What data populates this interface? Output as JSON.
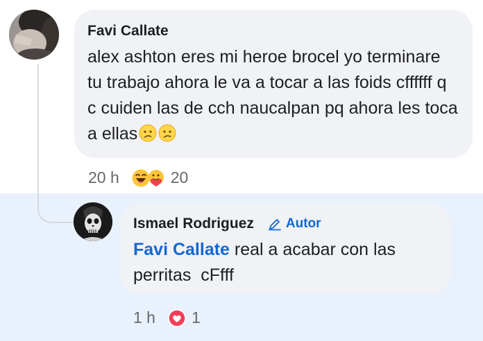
{
  "colors": {
    "mention": "#1467d6",
    "reply_background": "#e9f1fc",
    "bubble_background": "#f0f2f5",
    "heart_reaction": "#f33e58"
  },
  "comment": {
    "author": "Favi Callate",
    "text": "alex ashton eres mi heroe brocel yo terminare tu trabajo ahora le va a tocar a las foids cffffff q c cuiden las de cch naucalpan pq ahora les toca a ellas",
    "trailing_emojis": [
      "slightly-frowning-face-icon",
      "slightly-frowning-face-icon"
    ],
    "time": "20 h",
    "reactions": [
      "laughing-face-icon",
      "hugging-face-icon"
    ],
    "reaction_count": "20"
  },
  "reply": {
    "author": "Ismael Rodriguez",
    "badge": "Autor",
    "badge_icon": "pencil-icon",
    "mention": "Favi Callate",
    "text": " real a acabar con las perritas  cFfff",
    "time": "1 h",
    "reactions": [
      "heart-icon"
    ],
    "reaction_count": "1"
  }
}
